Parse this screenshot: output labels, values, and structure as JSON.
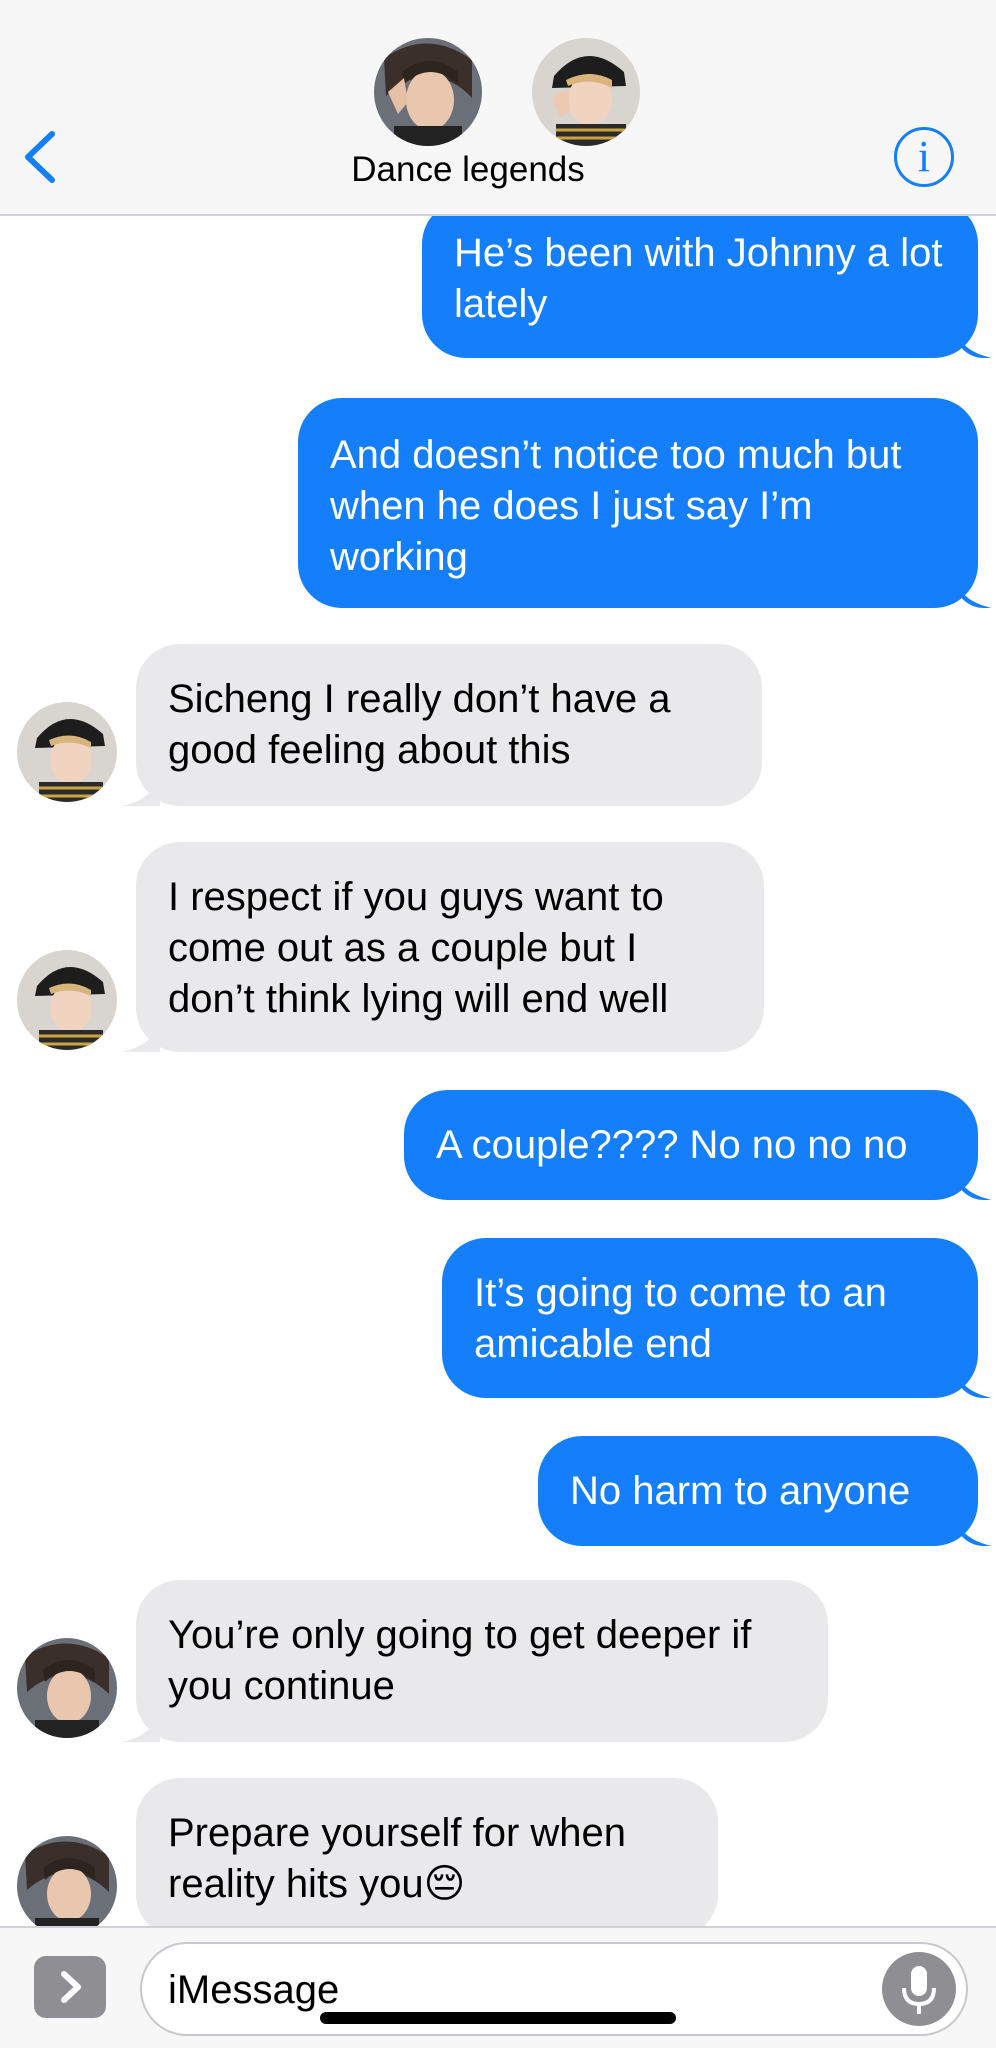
{
  "header": {
    "title": "Dance legends",
    "back_icon": "chevron-left-icon",
    "info_icon": "info-icon",
    "info_glyph": "i"
  },
  "messages": [
    {
      "side": "sent",
      "text": "He’s been with Johnny a lot lately"
    },
    {
      "side": "sent",
      "text": "And doesn’t notice too much but when he does I just say I’m working"
    },
    {
      "side": "received",
      "sender_avatar": "avatar-b",
      "text": "Sicheng I really don’t have a good feeling about this"
    },
    {
      "side": "received",
      "sender_avatar": "avatar-b",
      "text": "I respect if you guys want to come out as a couple but I don’t think lying will end well"
    },
    {
      "side": "sent",
      "text": "A couple???? No no no no"
    },
    {
      "side": "sent",
      "text": "It’s going to come to an amicable end"
    },
    {
      "side": "sent",
      "text": "No harm to anyone"
    },
    {
      "side": "received",
      "sender_avatar": "avatar-a",
      "text": "You’re only going to get deeper if you continue"
    },
    {
      "side": "received",
      "sender_avatar": "avatar-a",
      "text": "Prepare yourself for when reality hits you😔"
    }
  ],
  "composer": {
    "placeholder": "iMessage",
    "apps_icon": "chevron-right-icon",
    "mic_icon": "microphone-icon"
  },
  "colors": {
    "sent_bubble": "#147efb",
    "received_bubble": "#e9e9eb",
    "accent": "#147efb"
  }
}
